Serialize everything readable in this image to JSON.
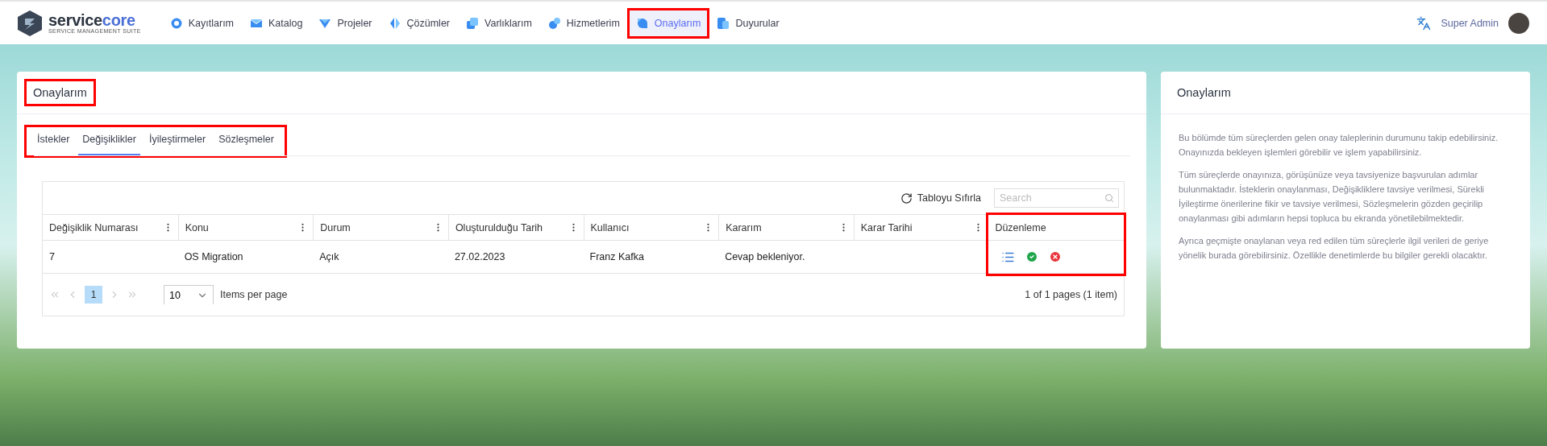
{
  "header": {
    "logo": {
      "wordmark": [
        "service",
        "core"
      ],
      "tagline": "SERVICE MANAGEMENT SUITE"
    },
    "nav": [
      {
        "label": "Kayıtlarım",
        "selected": false,
        "highlighted": false
      },
      {
        "label": "Katalog",
        "selected": false,
        "highlighted": false
      },
      {
        "label": "Projeler",
        "selected": false,
        "highlighted": false
      },
      {
        "label": "Çözümler",
        "selected": false,
        "highlighted": false
      },
      {
        "label": "Varlıklarım",
        "selected": false,
        "highlighted": false
      },
      {
        "label": "Hizmetlerim",
        "selected": false,
        "highlighted": false
      },
      {
        "label": "Onaylarım",
        "selected": true,
        "highlighted": true
      },
      {
        "label": "Duyurular",
        "selected": false,
        "highlighted": false
      }
    ],
    "user": {
      "name": "Super Admin"
    }
  },
  "main": {
    "title": "Onaylarım",
    "title_highlighted": true,
    "tabs_highlighted": true,
    "tabs": [
      {
        "label": "İstekler",
        "selected": false
      },
      {
        "label": "Değişiklikler",
        "selected": true
      },
      {
        "label": "İyileştirmeler",
        "selected": false
      },
      {
        "label": "Sözleşmeler",
        "selected": false
      }
    ],
    "table": {
      "reset_label": "Tabloyu Sıfırla",
      "search_placeholder": "Search",
      "actions_highlighted": true,
      "columns": [
        {
          "label": "Değişiklik Numarası",
          "menu": true
        },
        {
          "label": "Konu",
          "menu": true
        },
        {
          "label": "Durum",
          "menu": true
        },
        {
          "label": "Oluşturulduğu Tarih",
          "menu": true
        },
        {
          "label": "Kullanıcı",
          "menu": true
        },
        {
          "label": "Kararım",
          "menu": true
        },
        {
          "label": "Karar Tarihi",
          "menu": true
        },
        {
          "label": "Düzenleme",
          "menu": false
        }
      ],
      "rows": [
        {
          "cells": [
            "7",
            "OS Migration",
            "Açık",
            "27.02.2023",
            "Franz Kafka",
            "Cevap bekleniyor.",
            null
          ]
        }
      ],
      "pager": {
        "pages": [
          {
            "label": "1",
            "selected": true
          }
        ],
        "page_size": "10",
        "page_size_label": "Items per page",
        "summary": "1 of 1 pages (1 item)"
      }
    }
  },
  "info": {
    "title": "Onaylarım",
    "paragraphs": [
      "Bu bölümde tüm süreçlerden gelen onay taleplerinin durumunu takip edebilirsiniz. Onayınızda bekleyen işlemleri görebilir ve işlem yapabilirsiniz.",
      "Tüm süreçlerde onayınıza, görüşünüze veya tavsiyenize başvurulan adımlar bulunmaktadır. İsteklerin onaylanması, Değişikliklere tavsiye verilmesi, Sürekli İyileştirme önerilerine fikir ve tavsiye verilmesi, Sözleşmelerin gözden geçirilip onaylanması gibi adımların hepsi topluca bu ekranda yönetilebilmektedir.",
      "Ayrıca geçmişte onaylanan veya red edilen tüm süreçlerle ilgil verileri de geriye yönelik burada görebilirsiniz. Özellikle denetimlerde bu bilgiler gerekli olacaktır."
    ]
  }
}
